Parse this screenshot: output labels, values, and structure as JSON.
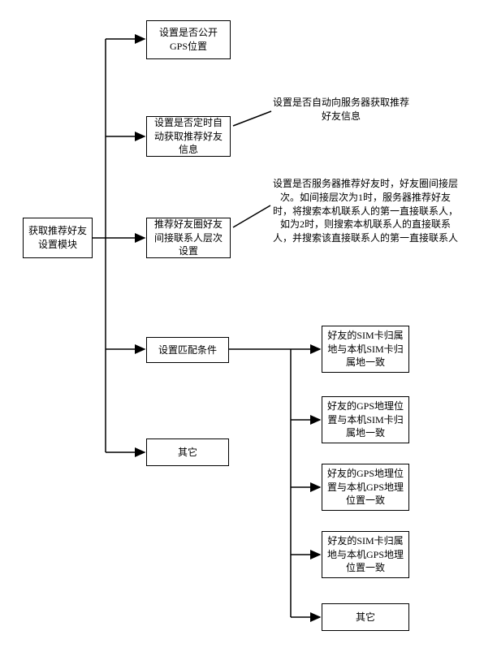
{
  "root": {
    "label": "获取推荐好友设置模块"
  },
  "level1": {
    "gps_public": "设置是否公开GPS位置",
    "auto_fetch": "设置是否定时自动获取推荐好友信息",
    "indirect_level": "推荐好友圈好友间接联系人层次设置",
    "match_conditions": "设置匹配条件",
    "other": "其它"
  },
  "annotations": {
    "auto_fetch_note": "设置是否自动向服务器获取推荐好友信息",
    "indirect_level_note": "设置是否服务器推荐好友时，好友圈间接层次。如间接层次为1时，服务器推荐好友时，将搜索本机联系人的第一直接联系人，如为2时，则搜索本机联系人的直接联系人，并搜索该直接联系人的第一直接联系人"
  },
  "match_conditions_children": {
    "sim_sim": "好友的SIM卡归属地与本机SIM卡归属地一致",
    "gps_sim": "好友的GPS地理位置与本机SIM卡归属地一致",
    "gps_gps": "好友的GPS地理位置与本机GPS地理位置一致",
    "sim_gps": "好友的SIM卡归属地与本机GPS地理位置一致",
    "other": "其它"
  }
}
